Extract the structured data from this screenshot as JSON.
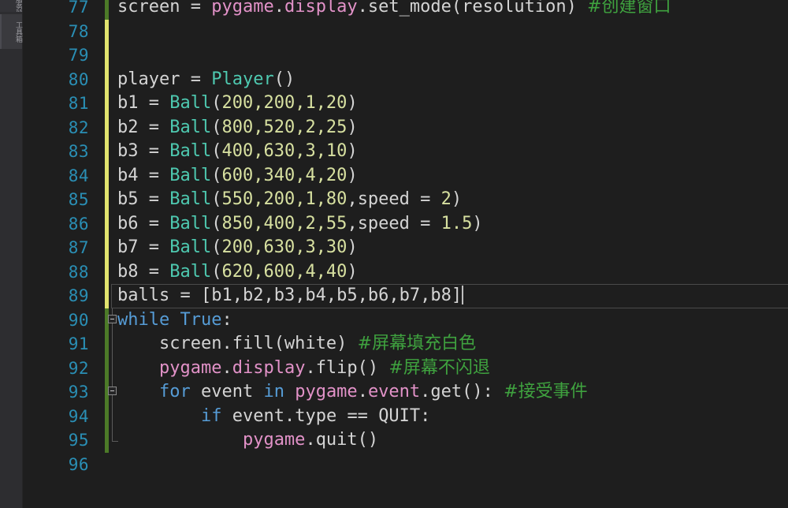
{
  "app": {
    "theme": "dark",
    "language": "Python",
    "colors": {
      "background": "#1e1e1e",
      "sidebar": "#2d2d30",
      "line_number": "#2a8fb5",
      "modified_bar": "#e1e36e",
      "added_bar": "#4c7a28",
      "keyword": "#569cd6",
      "type": "#4ec9b0",
      "module": "#e292c8",
      "number": "#d7e0a0",
      "comment": "#3fa23f",
      "text": "#d4d4d4",
      "caret": "#bfbfbf"
    }
  },
  "sidebar": {
    "tabs": [
      {
        "label": "服务器",
        "name": "server-explorer-tab"
      },
      {
        "label": "工具箱",
        "name": "toolbox-tab"
      }
    ]
  },
  "editor": {
    "current_line": 89,
    "caret_after": "balls = [b1,b2,b3,b4,b5,b6,b7,b8]",
    "first_visible_line": 77,
    "last_visible_line": 96,
    "lines": [
      {
        "number": "77",
        "change": "added",
        "fold": "none",
        "tokens": [
          {
            "t": "screen ",
            "c": "plain"
          },
          {
            "t": "= ",
            "c": "op"
          },
          {
            "t": "pygame",
            "c": "mod"
          },
          {
            "t": ".",
            "c": "punct"
          },
          {
            "t": "display",
            "c": "mod"
          },
          {
            "t": ".",
            "c": "punct"
          },
          {
            "t": "set_mode",
            "c": "plain"
          },
          {
            "t": "(resolution) ",
            "c": "plain"
          },
          {
            "t": "#创建窗口",
            "c": "comment"
          }
        ]
      },
      {
        "number": "78",
        "change": "modified",
        "fold": "none",
        "tokens": []
      },
      {
        "number": "79",
        "change": "modified",
        "fold": "none",
        "tokens": []
      },
      {
        "number": "80",
        "change": "modified",
        "fold": "none",
        "tokens": [
          {
            "t": "player ",
            "c": "plain"
          },
          {
            "t": "= ",
            "c": "op"
          },
          {
            "t": "Player",
            "c": "type"
          },
          {
            "t": "()",
            "c": "punct"
          }
        ]
      },
      {
        "number": "81",
        "change": "modified",
        "fold": "none",
        "tokens": [
          {
            "t": "b1 ",
            "c": "plain"
          },
          {
            "t": "= ",
            "c": "op"
          },
          {
            "t": "Ball",
            "c": "type"
          },
          {
            "t": "(",
            "c": "punct"
          },
          {
            "t": "200,200,1,20",
            "c": "num"
          },
          {
            "t": ")",
            "c": "punct"
          }
        ]
      },
      {
        "number": "82",
        "change": "modified",
        "fold": "none",
        "tokens": [
          {
            "t": "b2 ",
            "c": "plain"
          },
          {
            "t": "= ",
            "c": "op"
          },
          {
            "t": "Ball",
            "c": "type"
          },
          {
            "t": "(",
            "c": "punct"
          },
          {
            "t": "800,520,2,25",
            "c": "num"
          },
          {
            "t": ")",
            "c": "punct"
          }
        ]
      },
      {
        "number": "83",
        "change": "modified",
        "fold": "none",
        "tokens": [
          {
            "t": "b3 ",
            "c": "plain"
          },
          {
            "t": "= ",
            "c": "op"
          },
          {
            "t": "Ball",
            "c": "type"
          },
          {
            "t": "(",
            "c": "punct"
          },
          {
            "t": "400,630,3,10",
            "c": "num"
          },
          {
            "t": ")",
            "c": "punct"
          }
        ]
      },
      {
        "number": "84",
        "change": "modified",
        "fold": "none",
        "tokens": [
          {
            "t": "b4 ",
            "c": "plain"
          },
          {
            "t": "= ",
            "c": "op"
          },
          {
            "t": "Ball",
            "c": "type"
          },
          {
            "t": "(",
            "c": "punct"
          },
          {
            "t": "600,340,4,20",
            "c": "num"
          },
          {
            "t": ")",
            "c": "punct"
          }
        ]
      },
      {
        "number": "85",
        "change": "modified",
        "fold": "none",
        "tokens": [
          {
            "t": "b5 ",
            "c": "plain"
          },
          {
            "t": "= ",
            "c": "op"
          },
          {
            "t": "Ball",
            "c": "type"
          },
          {
            "t": "(",
            "c": "punct"
          },
          {
            "t": "550,200,1,80",
            "c": "num"
          },
          {
            "t": ",",
            "c": "punct"
          },
          {
            "t": "speed ",
            "c": "plain"
          },
          {
            "t": "= ",
            "c": "op"
          },
          {
            "t": "2",
            "c": "num"
          },
          {
            "t": ")",
            "c": "punct"
          }
        ]
      },
      {
        "number": "86",
        "change": "modified",
        "fold": "none",
        "tokens": [
          {
            "t": "b6 ",
            "c": "plain"
          },
          {
            "t": "= ",
            "c": "op"
          },
          {
            "t": "Ball",
            "c": "type"
          },
          {
            "t": "(",
            "c": "punct"
          },
          {
            "t": "850,400,2,55",
            "c": "num"
          },
          {
            "t": ",",
            "c": "punct"
          },
          {
            "t": "speed ",
            "c": "plain"
          },
          {
            "t": "= ",
            "c": "op"
          },
          {
            "t": "1.5",
            "c": "num"
          },
          {
            "t": ")",
            "c": "punct"
          }
        ]
      },
      {
        "number": "87",
        "change": "modified",
        "fold": "none",
        "tokens": [
          {
            "t": "b7 ",
            "c": "plain"
          },
          {
            "t": "= ",
            "c": "op"
          },
          {
            "t": "Ball",
            "c": "type"
          },
          {
            "t": "(",
            "c": "punct"
          },
          {
            "t": "200,630,3,30",
            "c": "num"
          },
          {
            "t": ")",
            "c": "punct"
          }
        ]
      },
      {
        "number": "88",
        "change": "modified",
        "fold": "none",
        "tokens": [
          {
            "t": "b8 ",
            "c": "plain"
          },
          {
            "t": "= ",
            "c": "op"
          },
          {
            "t": "Ball",
            "c": "type"
          },
          {
            "t": "(",
            "c": "punct"
          },
          {
            "t": "620,600,4,40",
            "c": "num"
          },
          {
            "t": ")",
            "c": "punct"
          }
        ]
      },
      {
        "number": "89",
        "change": "modified",
        "fold": "none",
        "current": true,
        "tokens": [
          {
            "t": "balls ",
            "c": "plain"
          },
          {
            "t": "= ",
            "c": "op"
          },
          {
            "t": "[b1,b2,b3,b4,b5,b6,b7,b8]",
            "c": "plain"
          }
        ]
      },
      {
        "number": "90",
        "change": "added",
        "fold": "box",
        "tokens": [
          {
            "t": "while ",
            "c": "kw"
          },
          {
            "t": "True",
            "c": "kw"
          },
          {
            "t": ":",
            "c": "punct"
          }
        ]
      },
      {
        "number": "91",
        "change": "added",
        "fold": "line",
        "tokens": [
          {
            "t": "    screen",
            "c": "plain"
          },
          {
            "t": ".",
            "c": "punct"
          },
          {
            "t": "fill",
            "c": "plain"
          },
          {
            "t": "(white) ",
            "c": "plain"
          },
          {
            "t": "#屏幕填充白色",
            "c": "comment"
          }
        ]
      },
      {
        "number": "92",
        "change": "added",
        "fold": "line",
        "tokens": [
          {
            "t": "    ",
            "c": "plain"
          },
          {
            "t": "pygame",
            "c": "mod"
          },
          {
            "t": ".",
            "c": "punct"
          },
          {
            "t": "display",
            "c": "mod"
          },
          {
            "t": ".",
            "c": "punct"
          },
          {
            "t": "flip",
            "c": "plain"
          },
          {
            "t": "() ",
            "c": "plain"
          },
          {
            "t": "#屏幕不闪退",
            "c": "comment"
          }
        ]
      },
      {
        "number": "93",
        "change": "added",
        "fold": "box2",
        "tokens": [
          {
            "t": "    ",
            "c": "plain"
          },
          {
            "t": "for ",
            "c": "kw"
          },
          {
            "t": "event ",
            "c": "plain"
          },
          {
            "t": "in ",
            "c": "kw"
          },
          {
            "t": "pygame",
            "c": "mod"
          },
          {
            "t": ".",
            "c": "punct"
          },
          {
            "t": "event",
            "c": "mod"
          },
          {
            "t": ".",
            "c": "punct"
          },
          {
            "t": "get",
            "c": "plain"
          },
          {
            "t": "(): ",
            "c": "plain"
          },
          {
            "t": "#接受事件",
            "c": "comment"
          }
        ]
      },
      {
        "number": "94",
        "change": "added",
        "fold": "line",
        "tokens": [
          {
            "t": "        ",
            "c": "plain"
          },
          {
            "t": "if ",
            "c": "kw"
          },
          {
            "t": "event",
            "c": "plain"
          },
          {
            "t": ".",
            "c": "punct"
          },
          {
            "t": "type ",
            "c": "plain"
          },
          {
            "t": "== ",
            "c": "op"
          },
          {
            "t": "QUIT",
            "c": "plain"
          },
          {
            "t": ":",
            "c": "punct"
          }
        ]
      },
      {
        "number": "95",
        "change": "added",
        "fold": "lineend",
        "tokens": [
          {
            "t": "            ",
            "c": "plain"
          },
          {
            "t": "pygame",
            "c": "mod"
          },
          {
            "t": ".",
            "c": "punct"
          },
          {
            "t": "quit",
            "c": "plain"
          },
          {
            "t": "()",
            "c": "plain"
          }
        ]
      },
      {
        "number": "96",
        "change": "none",
        "fold": "none",
        "tokens": []
      }
    ]
  }
}
